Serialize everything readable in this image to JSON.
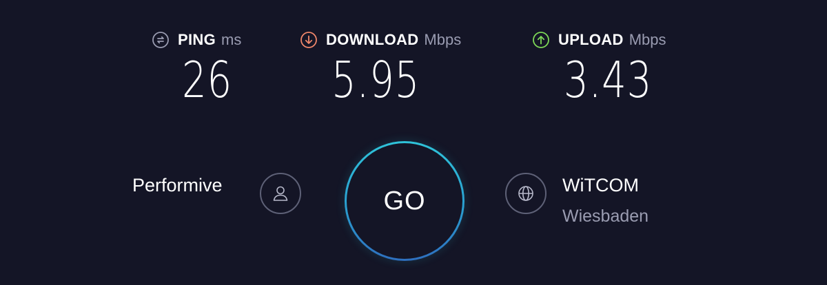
{
  "metrics": {
    "ping": {
      "name": "PING",
      "unit": "ms",
      "value": "26",
      "icon": "ping-icon",
      "color": "#9a9cb1"
    },
    "download": {
      "name": "DOWNLOAD",
      "unit": "Mbps",
      "value": "5.95",
      "icon": "download-arrow-icon",
      "color": "#f0876b"
    },
    "upload": {
      "name": "UPLOAD",
      "unit": "Mbps",
      "value": "3.43",
      "icon": "upload-arrow-icon",
      "color": "#7ed957"
    }
  },
  "provider": {
    "name": "Performive",
    "icon": "user-icon"
  },
  "go_button": {
    "label": "GO",
    "ring_color": "#2fc3d9"
  },
  "server": {
    "name": "WiTCOM",
    "location": "Wiesbaden",
    "icon": "globe-icon"
  },
  "colors": {
    "background": "#141526",
    "muted_text": "#9a9cb1",
    "icon_ring": "#5e6177"
  }
}
